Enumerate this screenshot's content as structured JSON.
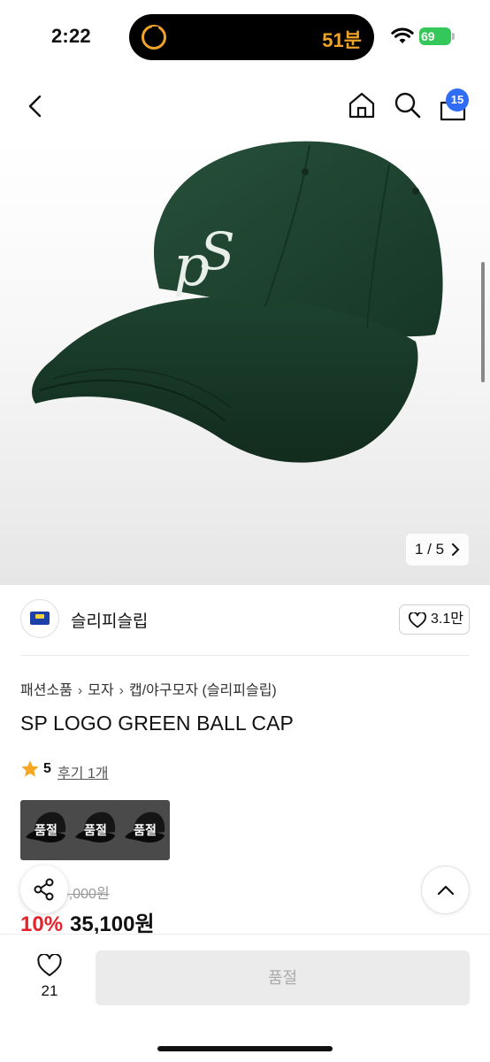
{
  "status_bar": {
    "time": "2:22",
    "timer": "51분",
    "battery": "69"
  },
  "header": {
    "cart_count": "15",
    "icons": [
      "back-icon",
      "home-icon",
      "search-icon",
      "shopping-bag-icon"
    ]
  },
  "gallery": {
    "pager": "1 / 5"
  },
  "brand": {
    "name": "슬리피슬립",
    "likes": "3.1만"
  },
  "breadcrumb": [
    "패션소품",
    "모자",
    "캡/야구모자 (슬리피슬립)"
  ],
  "product": {
    "title": "SP LOGO GREEN BALL CAP",
    "rating": "5",
    "reviews": "후기 1개",
    "options": [
      "품절",
      "품절",
      "품절"
    ],
    "original_price": "39,000원",
    "discount": "10%",
    "sale_price": "35,100원"
  },
  "bottom": {
    "wish_count": "21",
    "buy_label": "품절"
  },
  "colors": {
    "accent": "#2f6df6",
    "discount": "#e5232c",
    "cap_green": "#1f3f2c",
    "timer_orange": "#f0a329"
  }
}
